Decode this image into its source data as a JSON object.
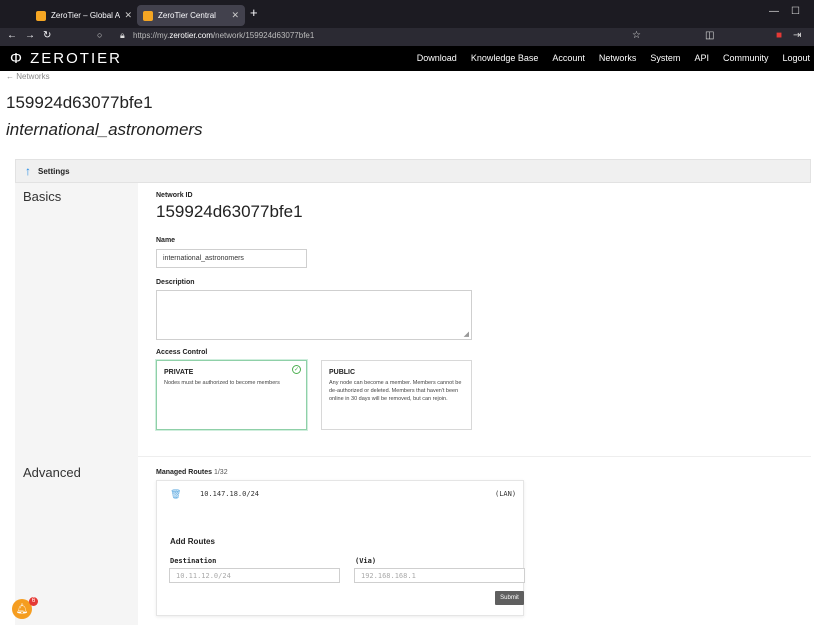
{
  "browser": {
    "tabs": [
      {
        "title": "ZeroTier – Global Area Network",
        "active": false
      },
      {
        "title": "ZeroTier Central",
        "active": true
      }
    ],
    "url_prefix": "https://my.",
    "url_domain": "zerotier.com",
    "url_path": "/network/159924d63077bfe1"
  },
  "appnav": {
    "brand": "Φ ZEROTIER",
    "links": [
      "Download",
      "Knowledge Base",
      "Account",
      "Networks",
      "System",
      "API",
      "Community",
      "Logout"
    ]
  },
  "page": {
    "back_link": "← Networks",
    "network_id_title": "159924d63077bfe1",
    "network_name_title": "international_astronomers"
  },
  "settings": {
    "bar_label": "Settings",
    "basics_heading": "Basics",
    "network_id_label": "Network ID",
    "network_id_value": "159924d63077bfe1",
    "name_label": "Name",
    "name_value": "international_astronomers",
    "description_label": "Description",
    "access_control_label": "Access Control",
    "private": {
      "title": "PRIVATE",
      "desc": "Nodes must be authorized to become members"
    },
    "public": {
      "title": "PUBLIC",
      "desc": "Any node can become a member. Members cannot be de-authorized or deleted. Members that haven't been online in 30 days will be removed, but can rejoin."
    }
  },
  "advanced": {
    "heading": "Advanced",
    "managed_routes_label": "Managed Routes",
    "managed_routes_count": "1/32",
    "route": {
      "ip": "10.147.18.0/24",
      "tag": "(LAN)"
    },
    "add_routes_label": "Add Routes",
    "destination_label": "Destination",
    "destination_placeholder": "10.11.12.0/24",
    "via_label": "(Via)",
    "via_placeholder": "192.168.168.1",
    "submit_label": "Submit"
  },
  "notification": {
    "count": "6"
  },
  "colors": {
    "accent": "#1e88e5",
    "nav_bg": "#000000",
    "selected_border": "#8fd0a8",
    "notif": "#f59d20"
  }
}
